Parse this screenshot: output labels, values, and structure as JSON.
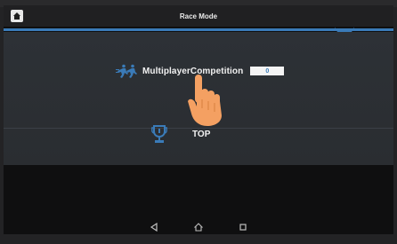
{
  "header": {
    "title": "Race Mode",
    "home_icon": "home-icon"
  },
  "menu": {
    "multiplayer": {
      "label": "MultiplayerCompetition",
      "icon": "runners-icon",
      "field_value": "0"
    },
    "top": {
      "label": "TOP",
      "icon": "trophy-icon"
    }
  },
  "overlay": {
    "icon": "pointing-hand-icon"
  },
  "navbar": {
    "items": [
      "back-icon",
      "home-icon",
      "recents-icon"
    ]
  },
  "colors": {
    "accent": "#3a7bb8",
    "panel": "#2d3136",
    "hand": "#f4a062"
  }
}
